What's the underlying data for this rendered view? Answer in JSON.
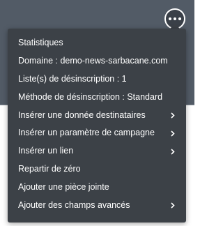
{
  "toolbar": {
    "more_icon": "more-options-dots-icon",
    "background_color": "#525b66"
  },
  "menu": {
    "background_color": "#3c4147",
    "text_color": "#ffffff",
    "items": [
      {
        "label": "Statistiques",
        "has_submenu": false
      },
      {
        "label": "Domaine : demo-news-sarbacane.com",
        "has_submenu": false
      },
      {
        "label": "Liste(s) de désinscription : 1",
        "has_submenu": false
      },
      {
        "label": "Méthode de désinscription : Standard",
        "has_submenu": false
      },
      {
        "label": "Insérer une donnée destinataires",
        "has_submenu": true
      },
      {
        "label": "Insérer un paramètre de campagne",
        "has_submenu": true
      },
      {
        "label": "Insérer un lien",
        "has_submenu": true
      },
      {
        "label": "Repartir de zéro",
        "has_submenu": false
      },
      {
        "label": "Ajouter une pièce jointe",
        "has_submenu": false
      },
      {
        "label": "Ajouter des champs avancés",
        "has_submenu": true
      }
    ]
  }
}
